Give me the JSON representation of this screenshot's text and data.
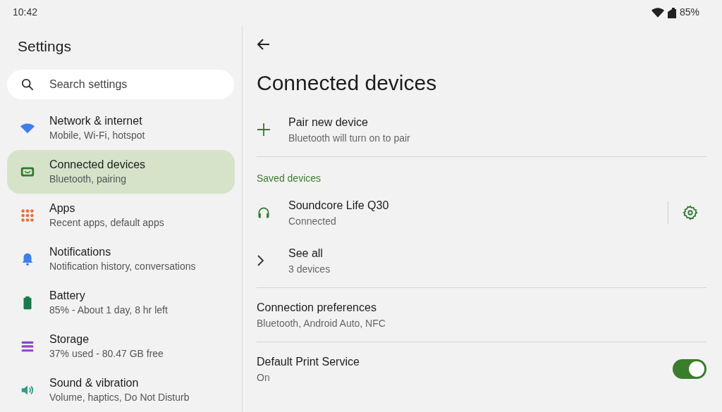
{
  "status_bar": {
    "time": "10:42",
    "battery": "85%"
  },
  "sidebar": {
    "title": "Settings",
    "search": {
      "placeholder": "Search settings"
    },
    "items": [
      {
        "color": "#3f7fe8",
        "title": "Network & internet",
        "subtitle": "Mobile, Wi-Fi, hotspot",
        "selected": false
      },
      {
        "color": "#2e7d32",
        "title": "Connected devices",
        "subtitle": "Bluetooth, pairing",
        "selected": true
      },
      {
        "color": "#e8703a",
        "title": "Apps",
        "subtitle": "Recent apps, default apps",
        "selected": false
      },
      {
        "color": "#3f7fe8",
        "title": "Notifications",
        "subtitle": "Notification history, conversations",
        "selected": false
      },
      {
        "color": "#1b7a4a",
        "title": "Battery",
        "subtitle": "85% - About 1 day, 8 hr left",
        "selected": false
      },
      {
        "color": "#8e44c9",
        "title": "Storage",
        "subtitle": "37% used - 80.47 GB free",
        "selected": false
      },
      {
        "color": "#2f9c8a",
        "title": "Sound & vibration",
        "subtitle": "Volume, haptics, Do Not Disturb",
        "selected": false
      }
    ]
  },
  "page": {
    "title": "Connected devices",
    "rows": [
      {
        "kind": "action",
        "title": "Pair new device",
        "subtitle": "Bluetooth will turn on to pair"
      },
      {
        "kind": "divider"
      },
      {
        "kind": "header",
        "title": "Saved devices"
      },
      {
        "kind": "device",
        "title": "Soundcore Life Q30",
        "subtitle": "Connected"
      },
      {
        "kind": "expand",
        "title": "See all",
        "subtitle": "3 devices"
      },
      {
        "kind": "divider"
      },
      {
        "kind": "plain",
        "title": "Connection preferences",
        "subtitle": "Bluetooth, Android Auto, NFC"
      },
      {
        "kind": "divider"
      },
      {
        "kind": "toggle",
        "title": "Default Print Service",
        "subtitle": "On",
        "on": true
      }
    ]
  }
}
